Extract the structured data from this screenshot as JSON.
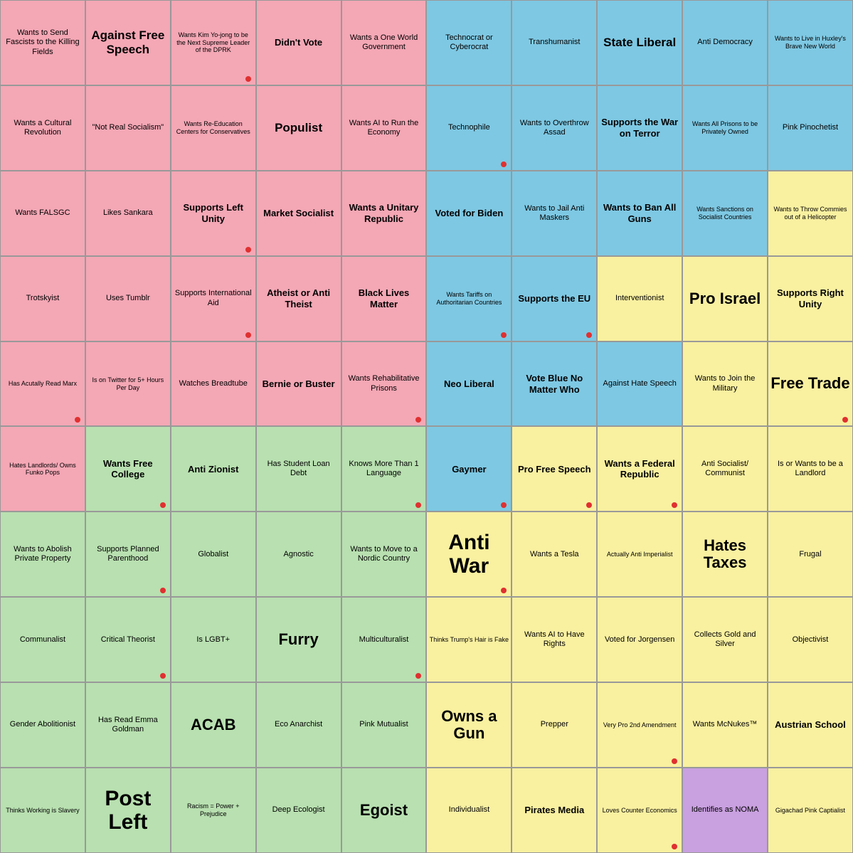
{
  "cells": [
    {
      "id": "r0c0",
      "text": "Wants to Send Fascists to the Killing Fields",
      "bg": "pink",
      "size": "small",
      "dot": false
    },
    {
      "id": "r0c1",
      "text": "Against Free Speech",
      "bg": "pink",
      "size": "large",
      "dot": false
    },
    {
      "id": "r0c2",
      "text": "Wants Kim Yo-jong to be the Next Supreme Leader of the DPRK",
      "bg": "pink",
      "size": "xsmall",
      "dot": true
    },
    {
      "id": "r0c3",
      "text": "Didn't Vote",
      "bg": "pink",
      "size": "medium",
      "dot": false
    },
    {
      "id": "r0c4",
      "text": "Wants a One World Government",
      "bg": "pink",
      "size": "small",
      "dot": false
    },
    {
      "id": "r0c5",
      "text": "Technocrat or Cyberocrat",
      "bg": "blue",
      "size": "small",
      "dot": false
    },
    {
      "id": "r0c6",
      "text": "Transhumanist",
      "bg": "blue",
      "size": "small",
      "dot": false
    },
    {
      "id": "r0c7",
      "text": "State Liberal",
      "bg": "blue",
      "size": "large",
      "dot": false
    },
    {
      "id": "r0c8",
      "text": "Anti Democracy",
      "bg": "blue",
      "size": "small",
      "dot": false
    },
    {
      "id": "r0c9",
      "text": "Wants to Live in Huxley's Brave New World",
      "bg": "blue",
      "size": "xsmall",
      "dot": false
    },
    {
      "id": "r1c0",
      "text": "Wants a Cultural Revolution",
      "bg": "pink",
      "size": "small",
      "dot": false
    },
    {
      "id": "r1c1",
      "text": "\"Not Real Socialism\"",
      "bg": "pink",
      "size": "small",
      "dot": false
    },
    {
      "id": "r1c2",
      "text": "Wants Re-Education Centers for Conservatives",
      "bg": "pink",
      "size": "xsmall",
      "dot": false
    },
    {
      "id": "r1c3",
      "text": "Populist",
      "bg": "pink",
      "size": "large",
      "dot": false
    },
    {
      "id": "r1c4",
      "text": "Wants AI to Run the Economy",
      "bg": "pink",
      "size": "small",
      "dot": false
    },
    {
      "id": "r1c5",
      "text": "Technophile",
      "bg": "blue",
      "size": "small",
      "dot": true
    },
    {
      "id": "r1c6",
      "text": "Wants to Overthrow Assad",
      "bg": "blue",
      "size": "small",
      "dot": false
    },
    {
      "id": "r1c7",
      "text": "Supports the War on Terror",
      "bg": "blue",
      "size": "medium",
      "dot": false
    },
    {
      "id": "r1c8",
      "text": "Wants All Prisons to be Privately Owned",
      "bg": "blue",
      "size": "xsmall",
      "dot": false
    },
    {
      "id": "r1c9",
      "text": "Pink Pinochetist",
      "bg": "blue",
      "size": "small",
      "dot": false
    },
    {
      "id": "r2c0",
      "text": "Wants FALSGC",
      "bg": "pink",
      "size": "small",
      "dot": false
    },
    {
      "id": "r2c1",
      "text": "Likes Sankara",
      "bg": "pink",
      "size": "small",
      "dot": false
    },
    {
      "id": "r2c2",
      "text": "Supports Left Unity",
      "bg": "pink",
      "size": "medium",
      "dot": true
    },
    {
      "id": "r2c3",
      "text": "Market Socialist",
      "bg": "pink",
      "size": "medium",
      "dot": false
    },
    {
      "id": "r2c4",
      "text": "Wants a Unitary Republic",
      "bg": "pink",
      "size": "medium",
      "dot": false
    },
    {
      "id": "r2c5",
      "text": "Voted for Biden",
      "bg": "blue",
      "size": "medium",
      "dot": false
    },
    {
      "id": "r2c6",
      "text": "Wants to Jail Anti Maskers",
      "bg": "blue",
      "size": "small",
      "dot": false
    },
    {
      "id": "r2c7",
      "text": "Wants to Ban All Guns",
      "bg": "blue",
      "size": "medium",
      "dot": false
    },
    {
      "id": "r2c8",
      "text": "Wants Sanctions on Socialist Countries",
      "bg": "blue",
      "size": "xsmall",
      "dot": false
    },
    {
      "id": "r2c9",
      "text": "Wants to Throw Commies out of a Helicopter",
      "bg": "yellow",
      "size": "xsmall",
      "dot": false
    },
    {
      "id": "r3c0",
      "text": "Trotskyist",
      "bg": "pink",
      "size": "small",
      "dot": false
    },
    {
      "id": "r3c1",
      "text": "Uses Tumblr",
      "bg": "pink",
      "size": "small",
      "dot": false
    },
    {
      "id": "r3c2",
      "text": "Supports International Aid",
      "bg": "pink",
      "size": "small",
      "dot": true
    },
    {
      "id": "r3c3",
      "text": "Atheist or Anti Theist",
      "bg": "pink",
      "size": "medium",
      "dot": false
    },
    {
      "id": "r3c4",
      "text": "Black Lives Matter",
      "bg": "pink",
      "size": "medium",
      "dot": false
    },
    {
      "id": "r3c5",
      "text": "Wants Tariffs on Authoritarian Countries",
      "bg": "blue",
      "size": "xsmall",
      "dot": true
    },
    {
      "id": "r3c6",
      "text": "Supports the EU",
      "bg": "blue",
      "size": "medium",
      "dot": true
    },
    {
      "id": "r3c7",
      "text": "Interventionist",
      "bg": "yellow",
      "size": "small",
      "dot": false
    },
    {
      "id": "r3c8",
      "text": "Pro Israel",
      "bg": "yellow",
      "size": "xlarge",
      "dot": false
    },
    {
      "id": "r3c9",
      "text": "Supports Right Unity",
      "bg": "yellow",
      "size": "medium",
      "dot": false
    },
    {
      "id": "r4c0",
      "text": "Has Acutally Read Marx",
      "bg": "pink",
      "size": "xsmall",
      "dot": true
    },
    {
      "id": "r4c1",
      "text": "Is on Twitter for 5+ Hours Per Day",
      "bg": "pink",
      "size": "xsmall",
      "dot": false
    },
    {
      "id": "r4c2",
      "text": "Watches Breadtube",
      "bg": "pink",
      "size": "small",
      "dot": false
    },
    {
      "id": "r4c3",
      "text": "Bernie or Buster",
      "bg": "pink",
      "size": "medium",
      "dot": false
    },
    {
      "id": "r4c4",
      "text": "Wants Rehabilitative Prisons",
      "bg": "pink",
      "size": "small",
      "dot": true
    },
    {
      "id": "r4c5",
      "text": "Neo Liberal",
      "bg": "blue",
      "size": "medium",
      "dot": false
    },
    {
      "id": "r4c6",
      "text": "Vote Blue No Matter Who",
      "bg": "blue",
      "size": "medium",
      "dot": false
    },
    {
      "id": "r4c7",
      "text": "Against Hate Speech",
      "bg": "blue",
      "size": "small",
      "dot": false
    },
    {
      "id": "r4c8",
      "text": "Wants to Join the Military",
      "bg": "yellow",
      "size": "small",
      "dot": false
    },
    {
      "id": "r4c9",
      "text": "Free Trade",
      "bg": "yellow",
      "size": "xlarge",
      "dot": true
    },
    {
      "id": "r5c0",
      "text": "Hates Landlords/ Owns Funko Pops",
      "bg": "pink",
      "size": "xsmall",
      "dot": false
    },
    {
      "id": "r5c1",
      "text": "Wants Free College",
      "bg": "green",
      "size": "medium",
      "dot": true
    },
    {
      "id": "r5c2",
      "text": "Anti Zionist",
      "bg": "green",
      "size": "medium",
      "dot": false
    },
    {
      "id": "r5c3",
      "text": "Has Student Loan Debt",
      "bg": "green",
      "size": "small",
      "dot": false
    },
    {
      "id": "r5c4",
      "text": "Knows More Than 1 Language",
      "bg": "green",
      "size": "small",
      "dot": true
    },
    {
      "id": "r5c5",
      "text": "Gaymer",
      "bg": "blue",
      "size": "medium",
      "dot": true
    },
    {
      "id": "r5c6",
      "text": "Pro Free Speech",
      "bg": "yellow",
      "size": "medium",
      "dot": true
    },
    {
      "id": "r5c7",
      "text": "Wants a Federal Republic",
      "bg": "yellow",
      "size": "medium",
      "dot": true
    },
    {
      "id": "r5c8",
      "text": "Anti Socialist/ Communist",
      "bg": "yellow",
      "size": "small",
      "dot": false
    },
    {
      "id": "r5c9",
      "text": "Is or Wants to be a Landlord",
      "bg": "yellow",
      "size": "small",
      "dot": false
    },
    {
      "id": "r6c0",
      "text": "Wants to Abolish Private Property",
      "bg": "green",
      "size": "small",
      "dot": false
    },
    {
      "id": "r6c1",
      "text": "Supports Planned Parenthood",
      "bg": "green",
      "size": "small",
      "dot": true
    },
    {
      "id": "r6c2",
      "text": "Globalist",
      "bg": "green",
      "size": "small",
      "dot": false
    },
    {
      "id": "r6c3",
      "text": "Agnostic",
      "bg": "green",
      "size": "small",
      "dot": false
    },
    {
      "id": "r6c4",
      "text": "Wants to Move to a Nordic Country",
      "bg": "green",
      "size": "small",
      "dot": false
    },
    {
      "id": "r6c5",
      "text": "Anti War",
      "bg": "yellow",
      "size": "xxlarge",
      "dot": true
    },
    {
      "id": "r6c6",
      "text": "Wants a Tesla",
      "bg": "yellow",
      "size": "small",
      "dot": false
    },
    {
      "id": "r6c7",
      "text": "Actually Anti Imperialist",
      "bg": "yellow",
      "size": "xsmall",
      "dot": false
    },
    {
      "id": "r6c8",
      "text": "Hates Taxes",
      "bg": "yellow",
      "size": "xlarge",
      "dot": false
    },
    {
      "id": "r6c9",
      "text": "Frugal",
      "bg": "yellow",
      "size": "small",
      "dot": false
    },
    {
      "id": "r7c0",
      "text": "Communalist",
      "bg": "green",
      "size": "small",
      "dot": false
    },
    {
      "id": "r7c1",
      "text": "Critical Theorist",
      "bg": "green",
      "size": "small",
      "dot": true
    },
    {
      "id": "r7c2",
      "text": "Is LGBT+",
      "bg": "green",
      "size": "small",
      "dot": false
    },
    {
      "id": "r7c3",
      "text": "Furry",
      "bg": "green",
      "size": "xlarge",
      "dot": false
    },
    {
      "id": "r7c4",
      "text": "Multiculturalist",
      "bg": "green",
      "size": "small",
      "dot": true
    },
    {
      "id": "r7c5",
      "text": "Thinks Trump's Hair is Fake",
      "bg": "yellow",
      "size": "xsmall",
      "dot": false
    },
    {
      "id": "r7c6",
      "text": "Wants AI to Have Rights",
      "bg": "yellow",
      "size": "small",
      "dot": false
    },
    {
      "id": "r7c7",
      "text": "Voted for Jorgensen",
      "bg": "yellow",
      "size": "small",
      "dot": false
    },
    {
      "id": "r7c8",
      "text": "Collects Gold and Silver",
      "bg": "yellow",
      "size": "small",
      "dot": false
    },
    {
      "id": "r7c9",
      "text": "Objectivist",
      "bg": "yellow",
      "size": "small",
      "dot": false
    },
    {
      "id": "r8c0",
      "text": "Gender Abolitionist",
      "bg": "green",
      "size": "small",
      "dot": false
    },
    {
      "id": "r8c1",
      "text": "Has Read Emma Goldman",
      "bg": "green",
      "size": "small",
      "dot": false
    },
    {
      "id": "r8c2",
      "text": "ACAB",
      "bg": "green",
      "size": "xlarge",
      "dot": false
    },
    {
      "id": "r8c3",
      "text": "Eco Anarchist",
      "bg": "green",
      "size": "small",
      "dot": false
    },
    {
      "id": "r8c4",
      "text": "Pink Mutualist",
      "bg": "green",
      "size": "small",
      "dot": false
    },
    {
      "id": "r8c5",
      "text": "Owns a Gun",
      "bg": "yellow",
      "size": "xlarge",
      "dot": false
    },
    {
      "id": "r8c6",
      "text": "Prepper",
      "bg": "yellow",
      "size": "small",
      "dot": false
    },
    {
      "id": "r8c7",
      "text": "Very Pro 2nd Amendment",
      "bg": "yellow",
      "size": "xsmall",
      "dot": true
    },
    {
      "id": "r8c8",
      "text": "Wants McNukes™",
      "bg": "yellow",
      "size": "small",
      "dot": false
    },
    {
      "id": "r8c9",
      "text": "Austrian School",
      "bg": "yellow",
      "size": "medium",
      "dot": false
    },
    {
      "id": "r9c0",
      "text": "Thinks Working is Slavery",
      "bg": "green",
      "size": "xsmall",
      "dot": false
    },
    {
      "id": "r9c1",
      "text": "Post Left",
      "bg": "green",
      "size": "xxlarge",
      "dot": false
    },
    {
      "id": "r9c2",
      "text": "Racism = Power + Prejudice",
      "bg": "green",
      "size": "xsmall",
      "dot": false
    },
    {
      "id": "r9c3",
      "text": "Deep Ecologist",
      "bg": "green",
      "size": "small",
      "dot": false
    },
    {
      "id": "r9c4",
      "text": "Egoist",
      "bg": "green",
      "size": "xlarge",
      "dot": false
    },
    {
      "id": "r9c5",
      "text": "Individualist",
      "bg": "yellow",
      "size": "small",
      "dot": false
    },
    {
      "id": "r9c6",
      "text": "Pirates Media",
      "bg": "yellow",
      "size": "medium",
      "dot": false
    },
    {
      "id": "r9c7",
      "text": "Loves Counter Economics",
      "bg": "yellow",
      "size": "xsmall",
      "dot": true
    },
    {
      "id": "r9c8",
      "text": "Identifies as NOMA",
      "bg": "purple",
      "size": "small",
      "dot": false
    },
    {
      "id": "r9c9",
      "text": "Gigachad Pink Captialist",
      "bg": "yellow",
      "size": "xsmall",
      "dot": false
    }
  ]
}
